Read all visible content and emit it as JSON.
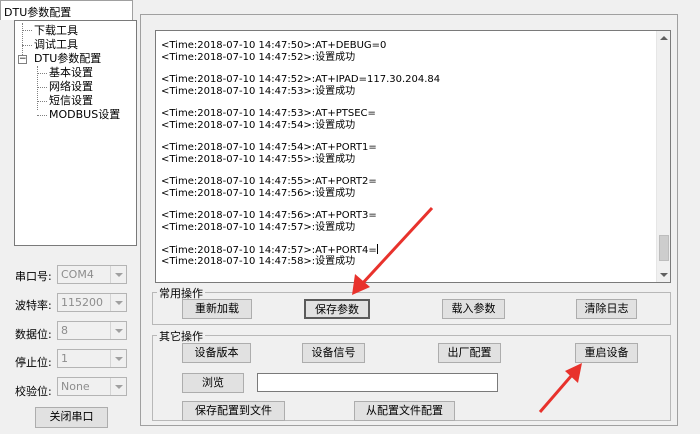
{
  "window": {
    "tab_title": "DTU参数配置"
  },
  "tree": {
    "items": [
      "下载工具",
      "调试工具",
      "DTU参数配置",
      "基本设置",
      "网络设置",
      "短信设置",
      "MODBUS设置"
    ],
    "expander_symbol": "−"
  },
  "serial": {
    "port_label": "串口号:",
    "port_value": "COM4",
    "baud_label": "波特率:",
    "baud_value": "115200",
    "databits_label": "数据位:",
    "databits_value": "8",
    "stopbits_label": "停止位:",
    "stopbits_value": "1",
    "parity_label": "校验位:",
    "parity_value": "None",
    "close_port_label": "关闭串口"
  },
  "log": {
    "lines": [
      [
        "<Time:2018-07-10 14:47:50>:AT+DEBUG=0",
        "<Time:2018-07-10 14:47:52>:设置成功"
      ],
      [
        "<Time:2018-07-10 14:47:52>:AT+IPAD=117.30.204.84",
        "<Time:2018-07-10 14:47:53>:设置成功"
      ],
      [
        "<Time:2018-07-10 14:47:53>:AT+PTSEC=",
        "<Time:2018-07-10 14:47:54>:设置成功"
      ],
      [
        "<Time:2018-07-10 14:47:54>:AT+PORT1=",
        "<Time:2018-07-10 14:47:55>:设置成功"
      ],
      [
        "<Time:2018-07-10 14:47:55>:AT+PORT2=",
        "<Time:2018-07-10 14:47:56>:设置成功"
      ],
      [
        "<Time:2018-07-10 14:47:56>:AT+PORT3=",
        "<Time:2018-07-10 14:47:57>:设置成功"
      ],
      [
        "<Time:2018-07-10 14:47:57>:AT+PORT4=",
        "<Time:2018-07-10 14:47:58>:设置成功"
      ]
    ]
  },
  "common_ops": {
    "label": "常用操作",
    "reload": "重新加载",
    "save_params": "保存参数",
    "load_params": "载入参数",
    "clear_log": "清除日志"
  },
  "other_ops": {
    "label": "其它操作",
    "device_version": "设备版本",
    "device_signal": "设备信号",
    "factory_config": "出厂配置",
    "restart_device": "重启设备",
    "browse": "浏览",
    "file_path_value": "",
    "save_config_to_file": "保存配置到文件",
    "config_from_file": "从配置文件配置"
  },
  "colors": {
    "annotation_arrow": "#e8322c"
  }
}
